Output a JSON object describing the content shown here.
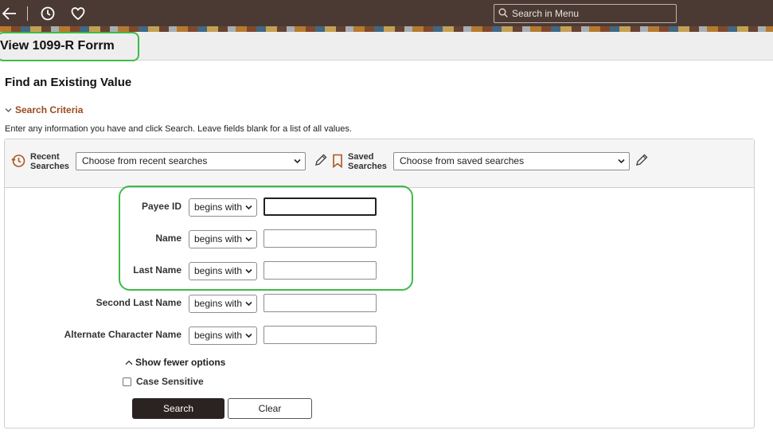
{
  "topbar": {
    "search_placeholder": "Search in Menu",
    "icons": [
      "back-arrow-icon",
      "history-icon",
      "favorite-heart-icon",
      "search-icon"
    ]
  },
  "page": {
    "title": "View 1099-R Forrm",
    "heading": "Find an Existing Value",
    "section_label": "Search Criteria",
    "instructions": "Enter any information you have and click Search. Leave fields blank for a list of all values."
  },
  "saved_bar": {
    "recent_label_1": "Recent",
    "recent_label_2": "Searches",
    "recent_value": "Choose from recent searches",
    "saved_label_1": "Saved",
    "saved_label_2": "Searches",
    "saved_value": "Choose from saved searches"
  },
  "fields": [
    {
      "label": "Payee ID",
      "operator": "begins with",
      "value": ""
    },
    {
      "label": "Name",
      "operator": "begins with",
      "value": ""
    },
    {
      "label": "Last Name",
      "operator": "begins with",
      "value": ""
    },
    {
      "label": "Second Last Name",
      "operator": "begins with",
      "value": ""
    },
    {
      "label": "Alternate Character Name",
      "operator": "begins with",
      "value": ""
    }
  ],
  "options": {
    "show_fewer": "Show fewer options",
    "case_sensitive": "Case Sensitive"
  },
  "buttons": {
    "search": "Search",
    "clear": "Clear"
  },
  "colors": {
    "accent_brown": "#9a4b1c",
    "highlight_green": "#3dbb4a",
    "topbar": "#4b3a33",
    "primary_button": "#2b2321"
  }
}
